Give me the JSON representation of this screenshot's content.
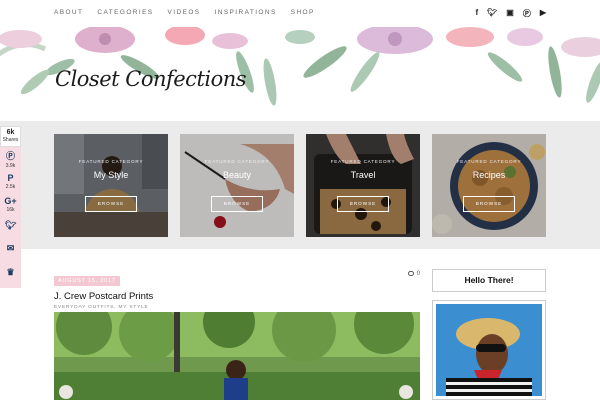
{
  "nav": {
    "items": [
      "ABOUT",
      "CATEGORIES",
      "VIDEOS",
      "INSPIRATIONS",
      "SHOP"
    ],
    "social_icons": [
      "facebook-icon",
      "twitter-icon",
      "instagram-icon",
      "pinterest-icon",
      "youtube-icon"
    ]
  },
  "header": {
    "logo": "Closet Confections"
  },
  "share": {
    "total": "6k",
    "total_label": "Shares",
    "buttons": [
      {
        "icon": "pinterest-icon",
        "count": "3.9k"
      },
      {
        "icon": "pinterest-p-icon",
        "count": "2.5k"
      },
      {
        "icon": "google-plus-icon",
        "count": "16k"
      },
      {
        "icon": "twitter-icon",
        "count": ""
      },
      {
        "icon": "email-icon",
        "count": ""
      },
      {
        "icon": "crown-icon",
        "count": ""
      }
    ]
  },
  "featured": {
    "kicker": "FEATURED CATEGORY",
    "browse_label": "BROWSE",
    "cards": [
      {
        "title": "My Style"
      },
      {
        "title": "Beauty"
      },
      {
        "title": "Travel"
      },
      {
        "title": "Recipes"
      }
    ]
  },
  "post": {
    "date": "AUGUST 15, 2017",
    "comments": "0",
    "title": "J. Crew Postcard Prints",
    "meta": "EVERYDAY OUTFITS, MY STYLE"
  },
  "sidebar": {
    "widget_title": "Hello There!"
  },
  "colors": {
    "accent_pink": "#f4c8d2",
    "share_bg": "#f7dde3",
    "band_bg": "#ebebeb"
  }
}
